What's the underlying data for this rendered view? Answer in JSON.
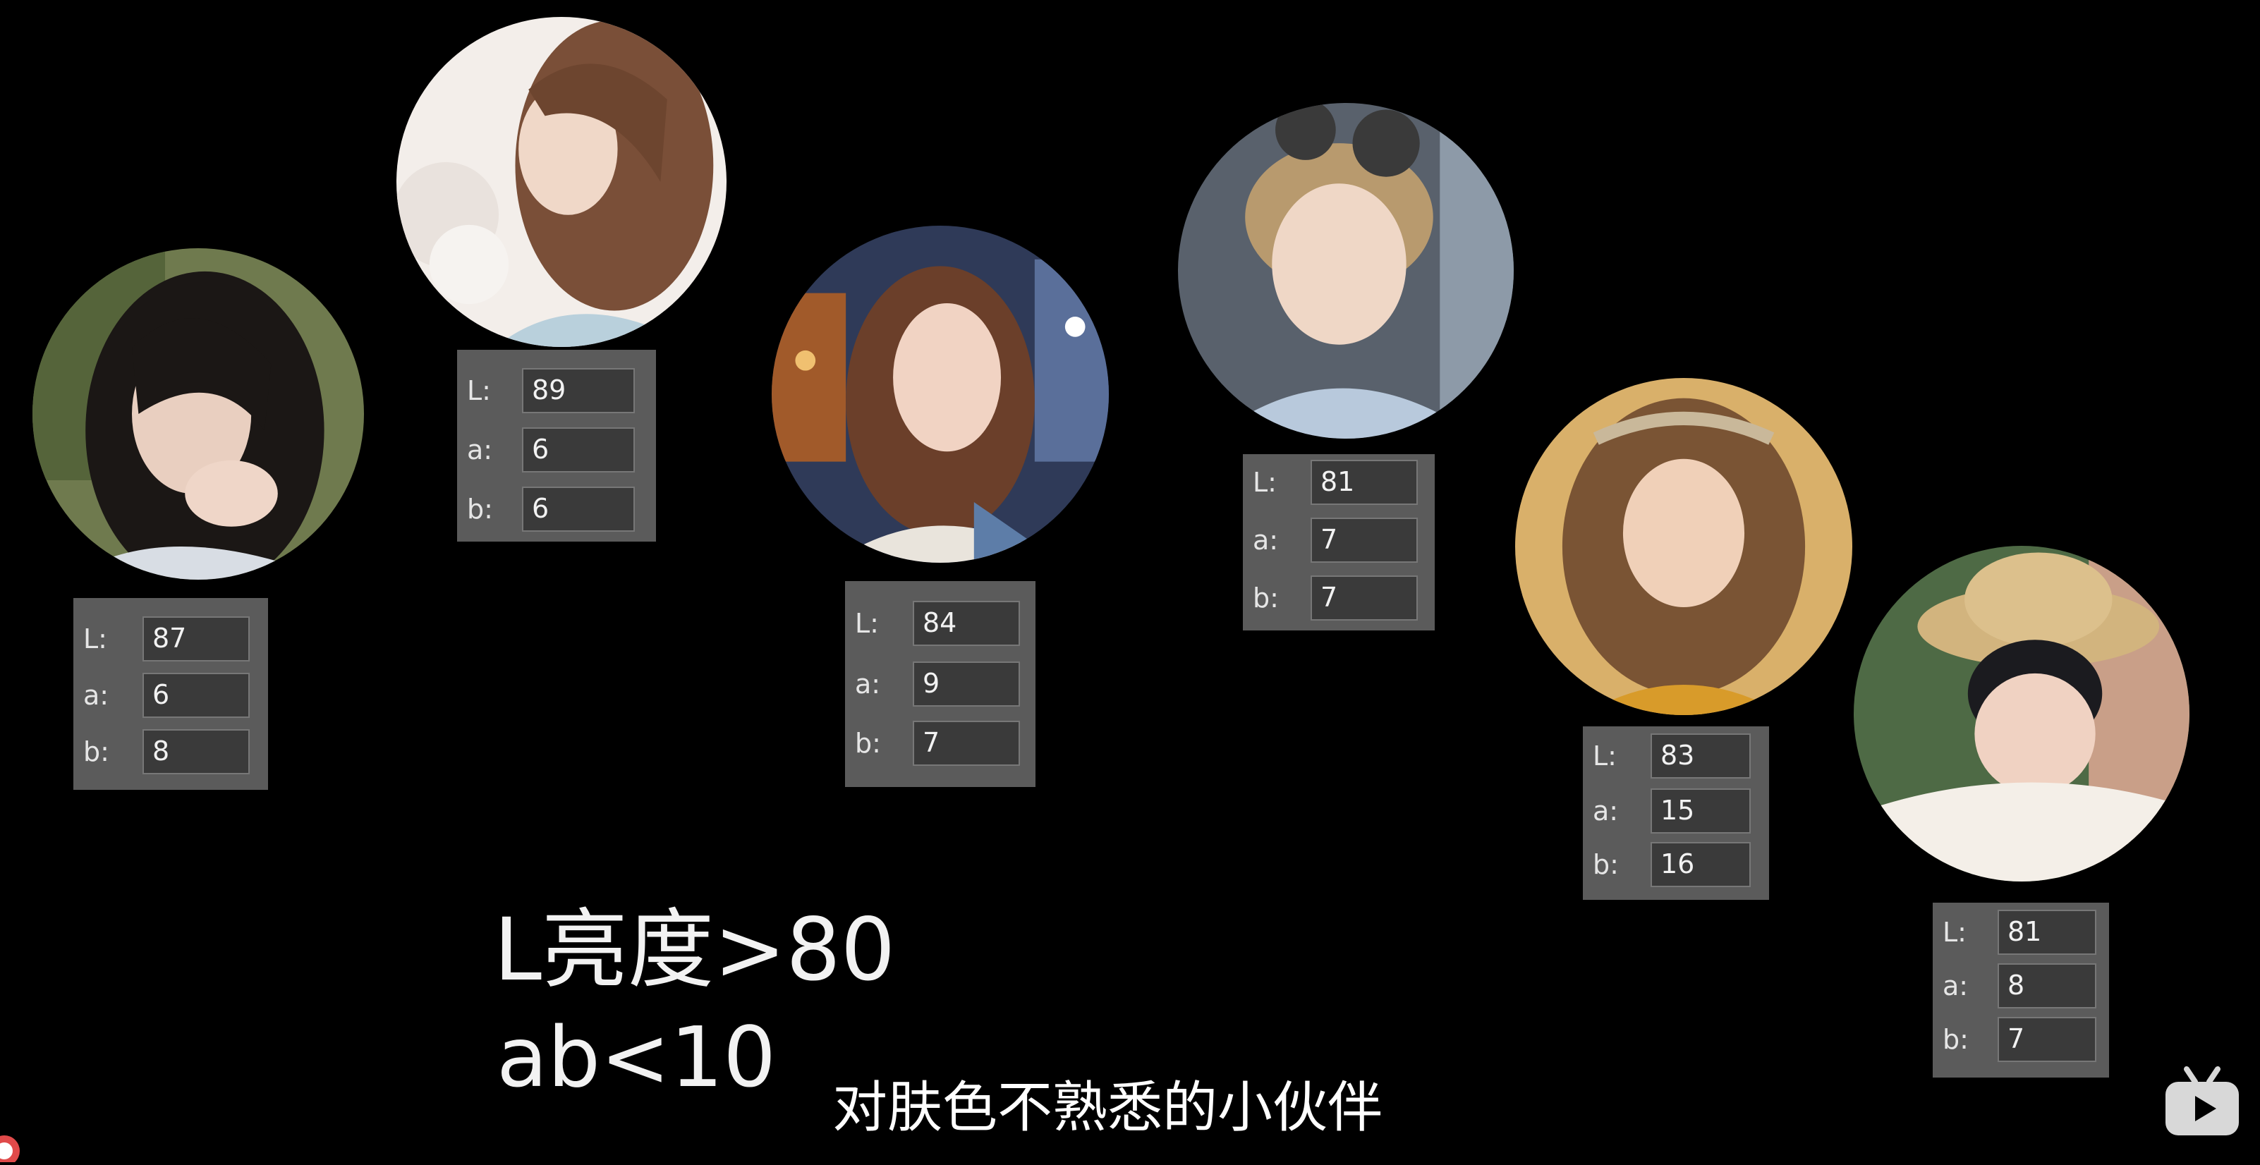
{
  "portraits": [
    {
      "name": "portrait-woman-dark-hair",
      "lab": {
        "L": "87",
        "a": "6",
        "b": "8"
      }
    },
    {
      "name": "portrait-woman-blossoms",
      "lab": {
        "L": "89",
        "a": "6",
        "b": "6"
      }
    },
    {
      "name": "portrait-woman-city",
      "lab": {
        "L": "84",
        "a": "9",
        "b": "7"
      }
    },
    {
      "name": "portrait-boy-goggles",
      "lab": {
        "L": "81",
        "a": "7",
        "b": "7"
      }
    },
    {
      "name": "portrait-girl-curly",
      "lab": {
        "L": "83",
        "a": "15",
        "b": "16"
      }
    },
    {
      "name": "portrait-boy-straw-hat",
      "lab": {
        "L": "81",
        "a": "8",
        "b": "7"
      }
    }
  ],
  "labels": {
    "L": "L:",
    "a": "a:",
    "b": "b:"
  },
  "rules": {
    "line1": "L亮度>80",
    "line2": "ab<10"
  },
  "subtitle": "对肤色不熟悉的小伙伴",
  "icons": {
    "bilibili": "bilibili-tv-icon"
  },
  "colors": {
    "background": "#000000",
    "panel": "#5b5b5b",
    "field": "#3a3a3a"
  }
}
